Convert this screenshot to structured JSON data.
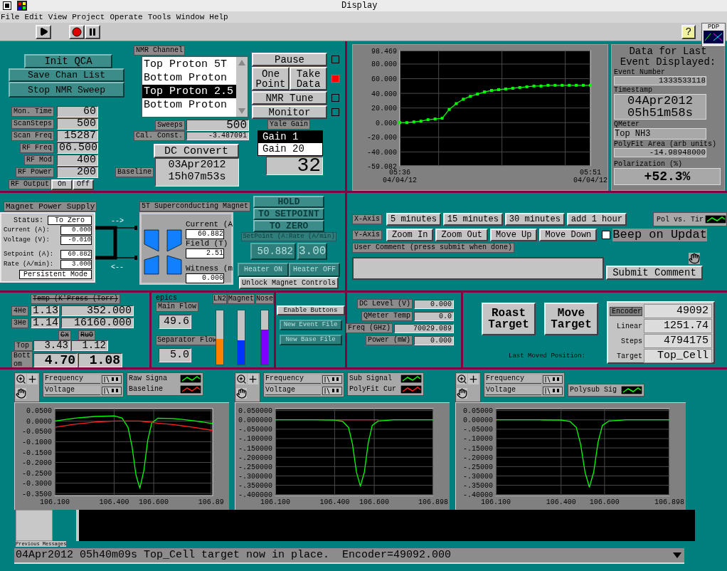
{
  "window": {
    "title": "Display"
  },
  "menu": [
    "File",
    "Edit",
    "View",
    "Project",
    "Operate",
    "Tools",
    "Window",
    "Help"
  ],
  "toolbar": {
    "help": "?",
    "logo": "PDP"
  },
  "qca": {
    "buttons": [
      "Init QCA",
      "Save Chan List",
      "Stop NMR Sweep"
    ],
    "params": [
      {
        "label": "Mon. Time",
        "value": "60"
      },
      {
        "label": "ScanSteps",
        "value": "500"
      },
      {
        "label": "Scan Freq",
        "value": "15287"
      },
      {
        "label": "RF Freq",
        "value": "06.500"
      },
      {
        "label": "RF Mod",
        "value": "400"
      },
      {
        "label": "RF Power",
        "value": "200"
      }
    ],
    "rf_output": {
      "label": "RF Output",
      "buttons": [
        "On",
        "Off"
      ]
    }
  },
  "nmr_channel": {
    "label": "NMR Channel",
    "items": [
      {
        "label": "Top Proton 5T",
        "selected": false
      },
      {
        "label": "Bottom Proton",
        "selected": false
      },
      {
        "label": "Top Proton 2.5",
        "selected": true
      },
      {
        "label": "Bottom Proton",
        "selected": false
      }
    ]
  },
  "sweeps": {
    "label": "Sweeps",
    "value": "500"
  },
  "cal_const": {
    "label": "Cal. Const.",
    "value": "-3.487091"
  },
  "dc_convert": "DC Convert",
  "baseline": {
    "label": "Baseline",
    "value": "03Apr2012 15h07m53s"
  },
  "action_rows": [
    {
      "buttons": [
        "Pause"
      ],
      "lamp_on": false
    },
    {
      "buttons": [
        "One Point",
        "Take Data"
      ],
      "lamp_on": true
    },
    {
      "buttons": [
        "NMR Tune"
      ],
      "lamp_on": false
    },
    {
      "buttons": [
        "Monitor"
      ],
      "lamp_on": false
    }
  ],
  "yale_gain": {
    "label": "Yale Gain",
    "items": [
      {
        "label": "Gain 1",
        "selected": true
      },
      {
        "label": "Gain 20",
        "selected": false
      }
    ],
    "value": "32"
  },
  "pol_chart": {
    "chart_data": {
      "type": "line",
      "grid": true,
      "categories": [
        "05:36 04/04/12",
        null,
        null,
        null,
        null,
        null,
        null,
        null,
        null,
        null,
        null,
        null,
        null,
        null,
        null,
        null,
        null,
        null,
        null,
        null,
        null,
        null,
        null,
        null,
        null,
        null,
        null,
        "05:51 04/04/12"
      ],
      "series": [
        {
          "name": "Pol vs. Tir",
          "color": "#00ff00",
          "marker": true,
          "values": [
            0,
            0,
            1,
            2,
            4,
            5,
            6,
            18,
            26,
            32,
            36,
            39,
            42,
            44,
            45,
            46,
            47,
            48,
            49,
            50,
            50,
            51,
            51,
            51,
            51,
            51,
            51,
            51
          ]
        }
      ],
      "ylim": [
        -59.082,
        98.469
      ],
      "yticks": [
        {
          "value": 98.469,
          "label": "98.469"
        },
        {
          "value": 80,
          "label": "80.000"
        },
        {
          "value": 60,
          "label": "60.000"
        },
        {
          "value": 40,
          "label": "40.000"
        },
        {
          "value": 20,
          "label": "20.000"
        },
        {
          "value": 0,
          "label": "0.000"
        },
        {
          "value": -20,
          "label": "-20.000"
        },
        {
          "value": -40,
          "label": "-40.000"
        },
        {
          "value": -59.082,
          "label": "-59.082"
        }
      ]
    }
  },
  "event_data": {
    "title": "Data for Last Event Displayed:",
    "fields": [
      {
        "label": "Event Number",
        "value": "1333533118",
        "kind": "small"
      },
      {
        "label": "Timestamp",
        "value": "04Apr2012 05h51m58s",
        "kind": "big"
      },
      {
        "label": "QMeter",
        "value": "Top NH3",
        "kind": "text"
      },
      {
        "label": "PolyFit Area (arb units)",
        "value": "-14.98948000",
        "kind": "small"
      },
      {
        "label": "Polarization (%)",
        "value": "+52.3%",
        "kind": "huge"
      }
    ]
  },
  "magnet_supply": {
    "title": "Magnet Power Supply",
    "status_label": "Status:",
    "status": "To Zero",
    "fields": [
      {
        "label": "Current (A):",
        "value": "0.000"
      },
      {
        "label": "Voltage (V):",
        "value": "-0.010"
      },
      {
        "label": "Setpoint (A):",
        "value": "60.882"
      },
      {
        "label": "Rate (A/min):",
        "value": "3.000"
      }
    ],
    "mode": "Persistent Mode"
  },
  "connection": {
    "arrows": [
      "-->",
      "<--"
    ]
  },
  "sc_magnet": {
    "title": "5T Superconducting Magnet",
    "fields": [
      {
        "label": "Current (A",
        "value": "60.882"
      },
      {
        "label": "Field (T)",
        "value": "2.51"
      },
      {
        "label": "Witness (m",
        "value": "0.000"
      }
    ]
  },
  "magnet_controls": {
    "disabled": true,
    "modes": [
      "HOLD",
      "TO SETPOINT",
      "TO ZERO"
    ],
    "setpoint_label": "SetPoint (A:Rate (A/min)",
    "setpoint": "50.882",
    "rate": "3.00",
    "heater": [
      "Heater ON",
      "Heater OFF"
    ],
    "unlock": "Unlock Magnet Controls"
  },
  "x_axis": {
    "label": "X-Axis",
    "buttons": [
      "5 minutes",
      "15 minutes",
      "30 minutes",
      "add 1 hour"
    ]
  },
  "y_axis": {
    "label": "Y-Axis",
    "buttons": [
      "Zoom In",
      "Zoom Out",
      "Move Up",
      "Move Down"
    ]
  },
  "beep": {
    "label": "Beep on Updat",
    "checked": false
  },
  "comment": {
    "label": "User Comment (press submit when done)",
    "submit": "Submit Comment"
  },
  "temps": {
    "title": "Temp (K'Press (Torr)",
    "rows": [
      {
        "label": "4He",
        "temp": "1.13",
        "press": "352.000"
      },
      {
        "label": "3He",
        "temp": "1.14",
        "press": "16160.000"
      }
    ],
    "columns": [
      "Cx",
      "RuO"
    ],
    "sensors": [
      {
        "label": "Top",
        "values": [
          "3.43",
          "1.12"
        ],
        "kind": "normal"
      },
      {
        "label": "Bottom",
        "values": [
          "4.70",
          "1.08"
        ],
        "kind": "bold"
      }
    ]
  },
  "flows": {
    "source": "epics",
    "main": {
      "label": "Main Flow",
      "value": "49.6"
    },
    "separator": {
      "label": "Separator Flow",
      "value": "5.0"
    },
    "tanks": [
      {
        "label": "LN2",
        "level": 0.47,
        "color": "#ff8000"
      },
      {
        "label": "Magnet",
        "level": 0.45,
        "color": "#0033ff"
      },
      {
        "label": "Nose",
        "level": 0.65,
        "color": "#8000ff"
      }
    ]
  },
  "file_buttons": {
    "enable": "Enable Buttons",
    "items": [
      {
        "label": "New Event File",
        "disabled": true
      },
      {
        "label": "New Base File",
        "disabled": true
      }
    ]
  },
  "microwave": {
    "fields": [
      {
        "label": "DC Level (V)",
        "value": "0.000"
      },
      {
        "label": "QMeter Temp",
        "value": "0.0"
      },
      {
        "label": "Freq (GHz)",
        "value": "70029.089"
      },
      {
        "label": "Power (mW)",
        "value": "0.000"
      }
    ]
  },
  "target": {
    "buttons": [
      "Roast Target",
      "Move Target"
    ],
    "caption": "Last Moved Position:",
    "fields": [
      {
        "label": "Encoder",
        "value": "49092"
      },
      {
        "label": "Linear",
        "value": "1251.74"
      },
      {
        "label": "Steps",
        "value": "4794175"
      },
      {
        "label": "Target",
        "value": "Top_Cell"
      }
    ]
  },
  "graphs": [
    {
      "selectors": [
        "Frequency",
        "Voltage"
      ],
      "chart_data": {
        "type": "line",
        "grid": true,
        "x": [
          106.1,
          106.2,
          106.3,
          106.4,
          106.44,
          106.47,
          106.49,
          106.51,
          106.53,
          106.55,
          106.57,
          106.59,
          106.62,
          106.7,
          106.8,
          106.898
        ],
        "series": [
          {
            "name": "Raw Signa",
            "color": "#00ff00",
            "values": [
              0.0,
              0.014,
              0.022,
              0.025,
              0.015,
              -0.03,
              -0.12,
              -0.26,
              -0.325,
              -0.24,
              -0.09,
              -0.01,
              0.014,
              0.012,
              0.002,
              -0.012
            ]
          },
          {
            "name": "Baseline",
            "color": "#ff2020",
            "values": [
              -0.03,
              -0.015,
              -0.005,
              0.0,
              0.0,
              0.0,
              0.0,
              0.0,
              0.0,
              -0.002,
              -0.004,
              -0.006,
              -0.01,
              -0.017,
              -0.03,
              -0.045
            ]
          }
        ],
        "xlim": [
          106.1,
          106.898
        ],
        "ylim": [
          -0.36,
          0.06
        ],
        "xticks": [
          {
            "value": 106.1,
            "label": "106.100"
          },
          {
            "value": 106.4,
            "label": "106.400"
          },
          {
            "value": 106.6,
            "label": "106.600"
          },
          {
            "value": 106.89,
            "label": "106.89"
          }
        ],
        "yticks": [
          {
            "value": 0.05,
            "label": "0.0500"
          },
          {
            "value": 0,
            "label": "0.0000"
          },
          {
            "value": -0.05,
            "label": "-0.0500"
          },
          {
            "value": -0.1,
            "label": "-0.1000"
          },
          {
            "value": -0.15,
            "label": "-0.1500"
          },
          {
            "value": -0.2,
            "label": "-0.2000"
          },
          {
            "value": -0.25,
            "label": "-0.2500"
          },
          {
            "value": -0.3,
            "label": "-0.3000"
          },
          {
            "value": -0.35,
            "label": "-0.3500"
          }
        ]
      }
    },
    {
      "selectors": [
        "Frequency",
        "Voltage"
      ],
      "chart_data": {
        "type": "line",
        "grid": true,
        "x": [
          106.1,
          106.2,
          106.3,
          106.4,
          106.44,
          106.47,
          106.49,
          106.51,
          106.53,
          106.55,
          106.57,
          106.59,
          106.62,
          106.7,
          106.8,
          106.898
        ],
        "series": [
          {
            "name": "Sub Signal",
            "color": "#00ff00",
            "values": [
              0,
              0,
              0,
              -0.001,
              -0.008,
              -0.04,
              -0.13,
              -0.28,
              -0.355,
              -0.28,
              -0.12,
              -0.03,
              -0.006,
              0,
              0,
              0
            ]
          },
          {
            "name": "PolyFit Cur",
            "color": "#ff2020",
            "values": [
              null,
              null,
              null,
              0,
              0,
              0,
              0,
              0,
              0,
              0,
              0,
              0,
              0,
              null,
              null,
              null
            ]
          }
        ],
        "xlim": [
          106.1,
          106.898
        ],
        "ylim": [
          -0.405,
          0.06
        ],
        "xticks": [
          {
            "value": 106.1,
            "label": "106.100"
          },
          {
            "value": 106.4,
            "label": "106.400"
          },
          {
            "value": 106.6,
            "label": "106.600"
          },
          {
            "value": 106.898,
            "label": "106.898"
          }
        ],
        "yticks": [
          {
            "value": 0.05,
            "label": "0.050000"
          },
          {
            "value": 0,
            "label": "0.000000"
          },
          {
            "value": -0.05,
            "label": "-.050000"
          },
          {
            "value": -0.1,
            "label": "-.100000"
          },
          {
            "value": -0.15,
            "label": "-.150000"
          },
          {
            "value": -0.2,
            "label": "-.200000"
          },
          {
            "value": -0.25,
            "label": "-.250000"
          },
          {
            "value": -0.3,
            "label": "-.300000"
          },
          {
            "value": -0.35,
            "label": "-.350000"
          },
          {
            "value": -0.4,
            "label": "-.400000"
          }
        ]
      }
    },
    {
      "selectors": [
        "Frequency",
        "Voltage"
      ],
      "chart_data": {
        "type": "line",
        "grid": true,
        "x": [
          106.1,
          106.2,
          106.3,
          106.4,
          106.44,
          106.47,
          106.49,
          106.51,
          106.53,
          106.55,
          106.57,
          106.59,
          106.62,
          106.7,
          106.8,
          106.898
        ],
        "series": [
          {
            "name": "Polysub Sig",
            "color": "#00ff00",
            "values": [
              0,
              0,
              0,
              -0.001,
              -0.008,
              -0.04,
              -0.13,
              -0.28,
              -0.36,
              -0.28,
              -0.12,
              -0.03,
              -0.006,
              0,
              0,
              0
            ]
          }
        ],
        "xlim": [
          106.1,
          106.898
        ],
        "ylim": [
          -0.405,
          0.06
        ],
        "xticks": [
          {
            "value": 106.1,
            "label": "106.100"
          },
          {
            "value": 106.4,
            "label": "106.400"
          },
          {
            "value": 106.6,
            "label": "106.600"
          },
          {
            "value": 106.898,
            "label": "106.898"
          }
        ],
        "yticks": [
          {
            "value": 0.05,
            "label": "0.05000"
          },
          {
            "value": 0,
            "label": "0.00000"
          },
          {
            "value": -0.05,
            "label": "-.05000"
          },
          {
            "value": -0.1,
            "label": "-.10000"
          },
          {
            "value": -0.15,
            "label": "-.15000"
          },
          {
            "value": -0.2,
            "label": "-.20000"
          },
          {
            "value": -0.25,
            "label": "-.25000"
          },
          {
            "value": -0.3,
            "label": "-.30000"
          },
          {
            "value": -0.35,
            "label": "-.35000"
          },
          {
            "value": -0.4,
            "label": "-.40000"
          }
        ]
      }
    }
  ],
  "messages": {
    "label": "Previous Messages",
    "status": "04Apr2012 05h40m09s Top_Cell target now in place.  Encoder=49092.000"
  }
}
